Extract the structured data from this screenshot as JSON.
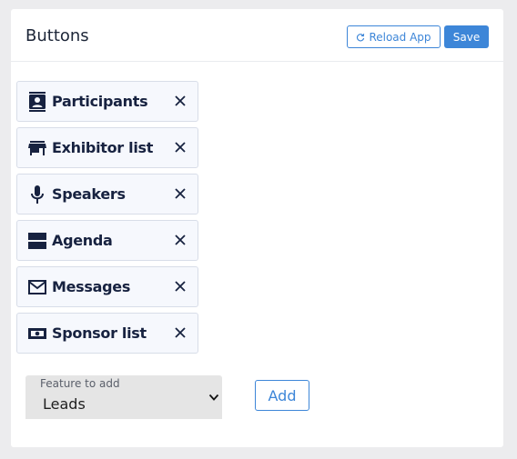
{
  "header": {
    "title": "Buttons",
    "reload_label": "Reload App",
    "save_label": "Save"
  },
  "features": [
    {
      "label": "Participants",
      "icon": "contact-card-icon"
    },
    {
      "label": "Exhibitor list",
      "icon": "storefront-icon"
    },
    {
      "label": "Speakers",
      "icon": "microphone-icon"
    },
    {
      "label": "Agenda",
      "icon": "agenda-icon"
    },
    {
      "label": "Messages",
      "icon": "envelope-icon"
    },
    {
      "label": "Sponsor list",
      "icon": "money-icon"
    }
  ],
  "add_feature": {
    "select_label": "Feature to add",
    "selected_value": "Leads",
    "add_label": "Add"
  },
  "colors": {
    "accent": "#3d86d8",
    "text_dark": "#172240",
    "item_bg": "#f6f8fd"
  }
}
